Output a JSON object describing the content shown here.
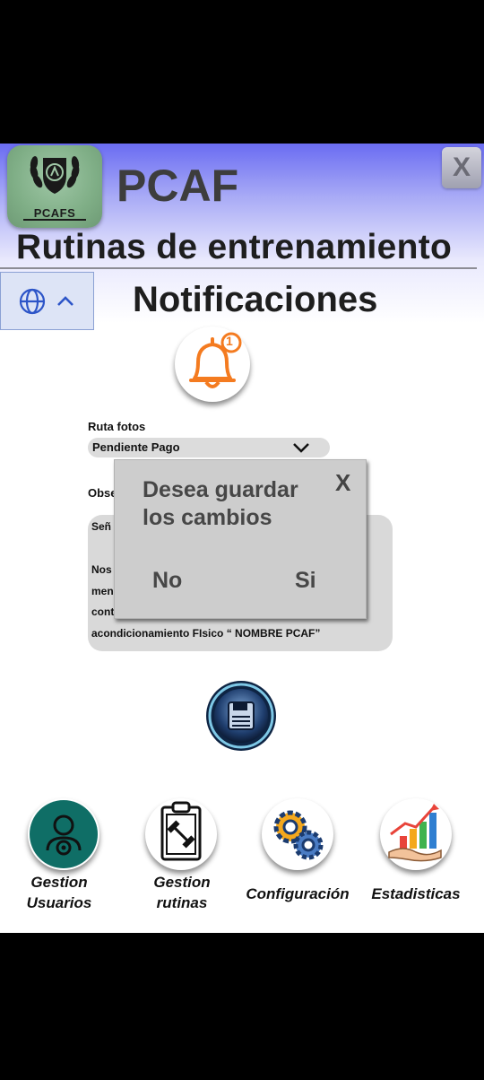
{
  "header": {
    "logo_text": "PCAFS",
    "app_name": "PCAF",
    "close_label": "X",
    "section_title": "Rutinas de entrenamiento"
  },
  "page": {
    "title": "Notificaciones",
    "notification_badge": "1"
  },
  "form": {
    "ruta_fotos_label": "Ruta fotos",
    "ruta_fotos_value": "Pendiente Pago",
    "observaciones_label": "Obse",
    "textbox_lines": [
      "Señ",
      "Nos",
      "men",
      "cont",
      "acondicionamiento FIsico “ NOMBRE PCAF”"
    ]
  },
  "dialog": {
    "message": "Desea guardar los cambios",
    "close_label": "X",
    "no_label": "No",
    "si_label": "Si"
  },
  "bottom_nav": [
    {
      "label": "Gestion Usuarios",
      "icon": "user-gear-icon"
    },
    {
      "label": "Gestion rutinas",
      "icon": "clipboard-dumbbell-icon"
    },
    {
      "label": "Configuración",
      "icon": "gears-icon"
    },
    {
      "label": "Estadisticas",
      "icon": "growth-chart-icon"
    }
  ],
  "colors": {
    "header_gradient_top": "#6a6cf2",
    "bell_orange": "#f47b20",
    "users_teal": "#0f6e66",
    "dialog_bg": "#cdcdcd"
  }
}
